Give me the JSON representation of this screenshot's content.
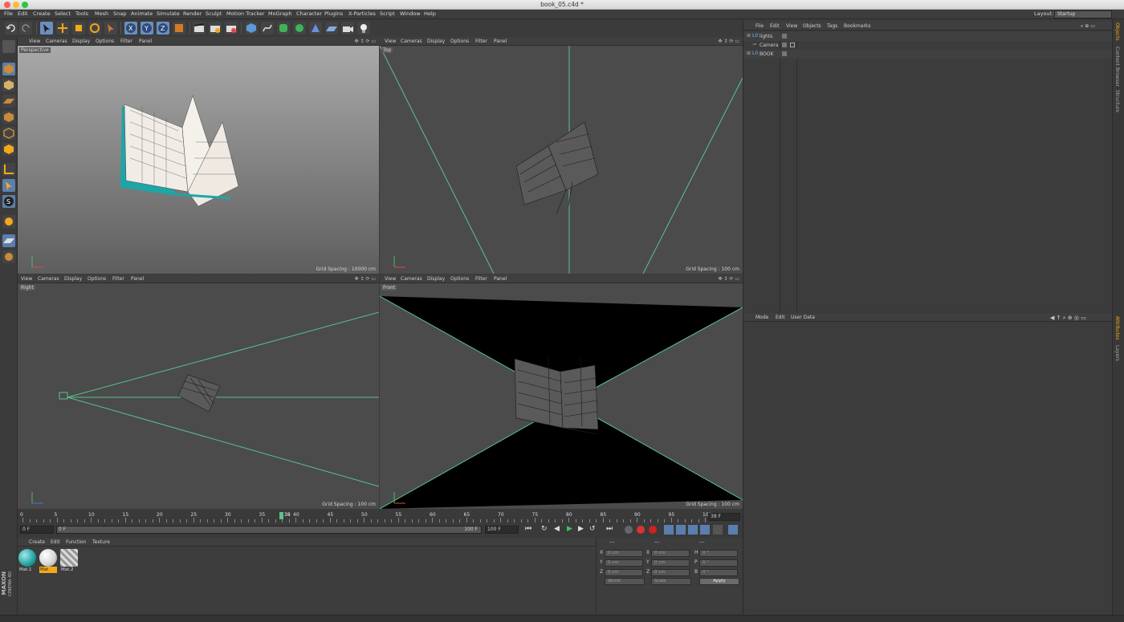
{
  "window": {
    "title": "book_05.c4d *"
  },
  "menu": [
    "File",
    "Edit",
    "Create",
    "Select",
    "Tools",
    "Mesh",
    "Snap",
    "Animate",
    "Simulate",
    "Render",
    "Sculpt",
    "Motion Tracker",
    "MoGraph",
    "Character",
    "Plugins",
    "X-Particles",
    "Script",
    "Window",
    "Help"
  ],
  "layout": {
    "label": "Layout:",
    "value": "Startup"
  },
  "viewport_menu": [
    "View",
    "Cameras",
    "Display",
    "Options",
    "Filter",
    "Panel"
  ],
  "viewports": {
    "perspective": {
      "label": "Perspective",
      "grid": "Grid Spacing : 10000 cm"
    },
    "top": {
      "label": "Top",
      "grid": "Grid Spacing : 100 cm"
    },
    "right": {
      "label": "Right",
      "grid": "Grid Spacing : 100 cm"
    },
    "front": {
      "label": "Front",
      "grid": "Grid Spacing : 100 cm"
    }
  },
  "timeline": {
    "ticks": [
      "0",
      "5",
      "10",
      "15",
      "20",
      "25",
      "30",
      "35",
      "40",
      "45",
      "50",
      "55",
      "60",
      "65",
      "70",
      "75",
      "80",
      "85",
      "90",
      "95",
      "10("
    ],
    "current_frame": "38",
    "frame_field": "38 F",
    "start_field": "0 F",
    "range_start": "0 F",
    "range_end": "100 F",
    "end_field": "100 F"
  },
  "material_menu": [
    "Create",
    "Edit",
    "Function",
    "Texture"
  ],
  "materials": [
    {
      "name": "Mat.1",
      "color": "#2aa7a8"
    },
    {
      "name": "Mat",
      "color": "#e8e8e8"
    },
    {
      "name": "Mat.2",
      "color": "#bdbdbd"
    }
  ],
  "coords": {
    "headers": [
      "---",
      "---",
      "---"
    ],
    "rows": [
      {
        "a": "X",
        "av": "0 cm",
        "b": "X",
        "bv": "0 cm",
        "c": "H",
        "cv": "0 °"
      },
      {
        "a": "Y",
        "av": "0 cm",
        "b": "Y",
        "bv": "0 cm",
        "c": "P",
        "cv": "0 °"
      },
      {
        "a": "Z",
        "av": "0 cm",
        "b": "Z",
        "bv": "0 cm",
        "c": "B",
        "cv": "0 °"
      }
    ],
    "world": "World",
    "scale": "Scale",
    "apply": "Apply"
  },
  "object_menu": [
    "File",
    "Edit",
    "View",
    "Objects",
    "Tags",
    "Bookmarks"
  ],
  "objects": [
    {
      "name": "lights"
    },
    {
      "name": "Camera"
    },
    {
      "name": "BOOK"
    }
  ],
  "attr_menu": [
    "Mode",
    "Edit",
    "User Data"
  ],
  "right_tabs": {
    "top": [
      "Objects",
      "Content Browser",
      "Structure"
    ],
    "bottom": [
      "Attributes",
      "Layers"
    ]
  },
  "logo": {
    "line1": "MAXON",
    "line2": "CINEMA 4D"
  },
  "colors": {
    "accent": "#58c28f",
    "ui_bg": "#3a3a3a",
    "viewport_bg": "#4b4b4b",
    "highlight": "#f3a81a"
  }
}
